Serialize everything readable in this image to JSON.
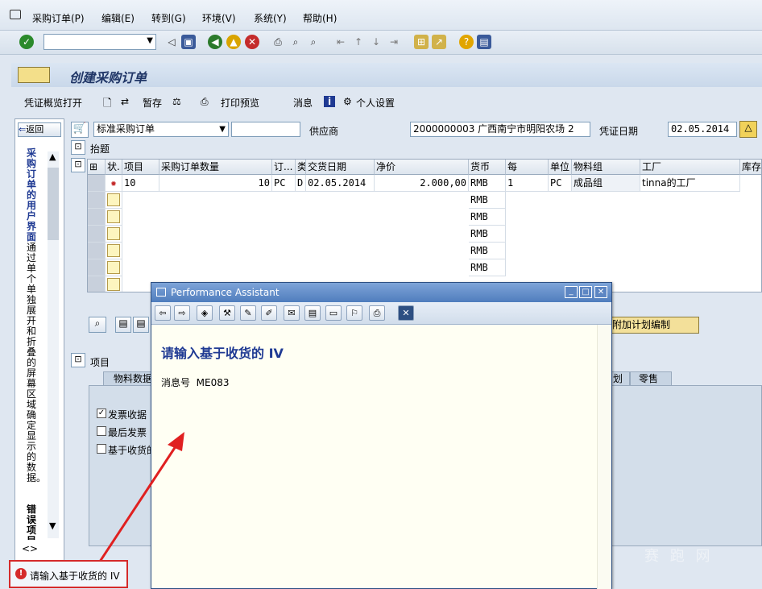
{
  "menu": {
    "items": [
      "采购订单(P)",
      "编辑(E)",
      "转到(G)",
      "环境(V)",
      "系统(Y)",
      "帮助(H)"
    ]
  },
  "title": {
    "text": "创建采购订单"
  },
  "app_toolbar": {
    "overview": "凭证概览打开",
    "hold": "暂存",
    "print_preview": "打印预览",
    "messages": "消息",
    "personal": "个人设置"
  },
  "left_pane": {
    "back": "返回",
    "text_bold": "采购订单的用户界面",
    "text_rest": "通过单个单独展开和折叠的屏幕区域确定显示的数据。",
    "text_bold2": "错误项目"
  },
  "header": {
    "doc_type": "标准采购订单",
    "vendor_label": "供应商",
    "vendor_value": "2000000003 广西南宁市明阳农场 2",
    "doc_date_label": "凭证日期",
    "doc_date_value": "02.05.2014",
    "header_section": "抬题"
  },
  "grid": {
    "columns": [
      "状.",
      "项目",
      "采购订单数量",
      "订...",
      "类",
      "交货日期",
      "净价",
      "货币",
      "每",
      "单位",
      "物料组",
      "工厂",
      "库存地"
    ],
    "row1": {
      "item": "10",
      "qty": "10",
      "unit_code": "PC",
      "cat": "D",
      "date": "02.05.2014",
      "price": "2.000,00",
      "currency": "RMB",
      "per": "1",
      "unit": "PC",
      "matgroup": "成品组",
      "plant": "tinna的工厂"
    },
    "empty_currency": "RMB"
  },
  "item_section": {
    "label": "项目",
    "tab1": "物料数据",
    "tab_r1": "划",
    "tab_r2": "零售",
    "chk1": "发票收据",
    "chk2": "最后发票",
    "chk3": "基于收货的",
    "extra_button": "附加计划编制"
  },
  "pa": {
    "title": "Performance Assistant",
    "heading": "请输入基于收货的 IV",
    "msg_label": "消息号",
    "msg_id": "ME083"
  },
  "status": {
    "text": "请输入基于收货的 IV"
  },
  "watermark": "赛 跑 网",
  "colors": {
    "accent": "#1f3a93",
    "error": "#d52b2b",
    "pa_bg": "#fffff3"
  }
}
